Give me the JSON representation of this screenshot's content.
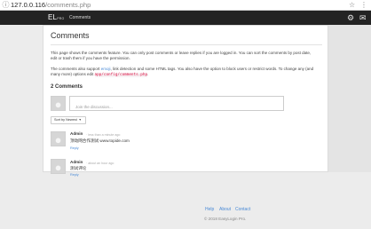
{
  "browser": {
    "url_host": "127.0.0.116",
    "url_path": "/comments.php"
  },
  "navbar": {
    "brand": "EL",
    "brand_sup": "PRO",
    "link_comments": "Comments"
  },
  "page": {
    "title": "Comments",
    "para1": "This page shows the comments feature. You can only post comments or leave replies if you are logged in. You can sort the comments by post date, edit or trash them if you have the permission.",
    "para2_a": "The comments also support ",
    "para2_link": "emoji",
    "para2_b": ", link detection and some HTML tags. You also have the option to block users or restrict words. To change any (and many more) options edit ",
    "para2_code": "app/config/comments.php",
    "para2_c": ".",
    "count_label": "2 Comments",
    "input_placeholder": "Join the discussion...",
    "sort_label": "Sort by Newest"
  },
  "comments": [
    {
      "author": "Admin",
      "time": "· less than a minute ago",
      "text": "顶动网合作测试 www.topide.com",
      "reply": "Reply"
    },
    {
      "author": "Admin",
      "time": "· about an hour ago",
      "text": "测试评论",
      "reply": "Reply"
    }
  ],
  "footer": {
    "help": "Help",
    "about": "About",
    "contact": "Contact",
    "copyright": "© 2018 EasyLogin Pro."
  }
}
